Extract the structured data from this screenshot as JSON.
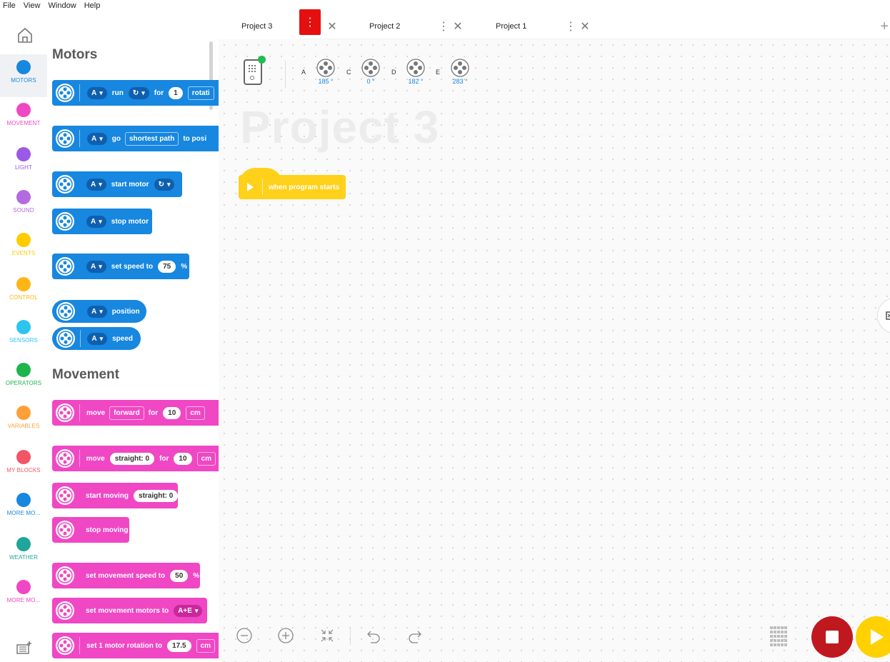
{
  "menu": [
    "File",
    "View",
    "Window",
    "Help"
  ],
  "rail": {
    "categories": [
      {
        "label": "MOTORS",
        "color": "#1787e0"
      },
      {
        "label": "MOVEMENT",
        "color": "#f047c4"
      },
      {
        "label": "LIGHT",
        "color": "#9b59e6"
      },
      {
        "label": "SOUND",
        "color": "#b46ae0"
      },
      {
        "label": "EVENTS",
        "color": "#ffcc00"
      },
      {
        "label": "CONTROL",
        "color": "#ffb515"
      },
      {
        "label": "SENSORS",
        "color": "#2bc5ef"
      },
      {
        "label": "OPERATORS",
        "color": "#1fb44c"
      },
      {
        "label": "VARIABLES",
        "color": "#ff9f3a"
      },
      {
        "label": "MY BLOCKS",
        "color": "#f25566"
      },
      {
        "label": "MORE MO...",
        "color": "#1787e0"
      },
      {
        "label": "WEATHER",
        "color": "#1fa59a"
      },
      {
        "label": "MORE MO...",
        "color": "#f047c4"
      }
    ]
  },
  "palette": {
    "motors_title": "Motors",
    "movement_title": "Movement",
    "motors": {
      "b1": {
        "port": "A",
        "run": "run",
        "dir": "↻",
        "for": "for",
        "num": "1",
        "unit": "rotati"
      },
      "b2": {
        "port": "A",
        "go": "go",
        "path": "shortest path",
        "to": "to posi"
      },
      "b3": {
        "port": "A",
        "text": "start motor",
        "dir": "↻"
      },
      "b4": {
        "port": "A",
        "text": "stop motor"
      },
      "b5": {
        "port": "A",
        "text": "set speed to",
        "num": "75",
        "unit": "%"
      },
      "b6": {
        "port": "A",
        "text": "position"
      },
      "b7": {
        "port": "A",
        "text": "speed"
      }
    },
    "movement": {
      "b1": {
        "move": "move",
        "dir": "forward",
        "for": "for",
        "num": "10",
        "unit": "cm"
      },
      "b2": {
        "move": "move",
        "steer": "straight: 0",
        "for": "for",
        "num": "10",
        "unit": "cm"
      },
      "b3": {
        "text": "start moving",
        "steer": "straight: 0"
      },
      "b4": {
        "text": "stop moving"
      },
      "b5": {
        "text": "set movement speed to",
        "num": "50",
        "unit": "%"
      },
      "b6": {
        "text": "set movement motors to",
        "val": "A+E"
      },
      "b7": {
        "text": "set 1 motor rotation to",
        "num": "17.5",
        "unit": "cm"
      }
    }
  },
  "tabs": [
    {
      "label": "Project 3",
      "active": true
    },
    {
      "label": "Project 2",
      "active": false
    },
    {
      "label": "Project 1",
      "active": false
    }
  ],
  "tab_add": "+",
  "hub": {
    "ports": [
      {
        "port": "A",
        "value": "185 °"
      },
      {
        "port": "C",
        "value": "0 °"
      },
      {
        "port": "D",
        "value": "182 °"
      },
      {
        "port": "E",
        "value": "283 °"
      }
    ]
  },
  "canvas": {
    "title": "Project 3",
    "hat_block": "when program starts"
  }
}
